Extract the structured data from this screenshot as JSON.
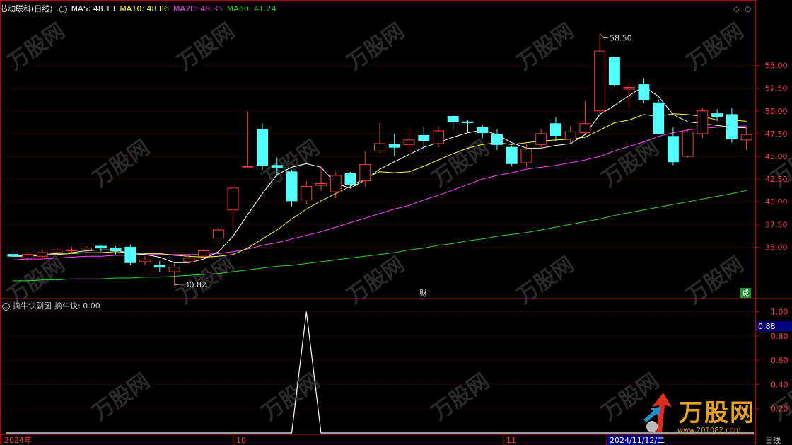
{
  "header": {
    "title": "芯动联科(日线)",
    "ma5": "MA5: 48.13",
    "ma10": "MA10: 48.86",
    "ma20": "MA20: 48.35",
    "ma60": "MA60: 41.24"
  },
  "sub_header": {
    "title": "擒牛诀副图",
    "value": "擒牛诀: 0.00"
  },
  "price_axis_ticks": [
    "55.00",
    "52.50",
    "50.00",
    "47.50",
    "45.00",
    "42.50",
    "40.00",
    "37.50",
    "35.00"
  ],
  "sub_axis_ticks": [
    "1.00",
    "0.80",
    "0.60",
    "0.40",
    "0.20"
  ],
  "sub_current_label": "0.88",
  "date_labels": [
    "2024年",
    "10",
    "11",
    "2024/11/12/二"
  ],
  "period_label": "日线",
  "annotations": {
    "high": "58.50",
    "low": "30.82",
    "cai": "财",
    "jian": "减"
  },
  "watermark": {
    "brand": "万股网",
    "url": "www.201082.com"
  },
  "colors": {
    "up": "#ff3b3b",
    "down": "#54ffff",
    "ma5": "#ffffff",
    "ma10": "#ffff40",
    "ma20": "#ff40ff",
    "ma60": "#30d030",
    "grid": "#800000",
    "axis": "#c00000",
    "tick_text": "#ff4040",
    "sub_line": "#ffffff"
  },
  "chart_data": [
    {
      "type": "candlestick",
      "title": "芯动联科(日线)",
      "y_ticks": [
        35.0,
        37.5,
        40.0,
        42.5,
        45.0,
        47.5,
        50.0,
        52.5,
        55.0
      ],
      "ylim": [
        29.5,
        60.5
      ],
      "candles": [
        {
          "o": 34.2,
          "c": 34.0,
          "h": 34.4,
          "l": 33.8
        },
        {
          "o": 33.8,
          "c": 34.2,
          "h": 34.5,
          "l": 33.4
        },
        {
          "o": 34.0,
          "c": 34.4,
          "h": 34.8,
          "l": 33.7
        },
        {
          "o": 34.4,
          "c": 34.7,
          "h": 34.9,
          "l": 34.1
        },
        {
          "o": 34.6,
          "c": 34.7,
          "h": 35.0,
          "l": 34.3
        },
        {
          "o": 34.7,
          "c": 34.9,
          "h": 35.1,
          "l": 34.4
        },
        {
          "o": 35.1,
          "c": 34.9,
          "h": 35.2,
          "l": 34.5
        },
        {
          "o": 34.9,
          "c": 34.6,
          "h": 35.1,
          "l": 34.2
        },
        {
          "o": 35.0,
          "c": 33.3,
          "h": 35.3,
          "l": 33.0
        },
        {
          "o": 33.4,
          "c": 33.6,
          "h": 34.0,
          "l": 33.0
        },
        {
          "o": 33.0,
          "c": 32.8,
          "h": 33.5,
          "l": 32.3
        },
        {
          "o": 32.3,
          "c": 32.8,
          "h": 33.2,
          "l": 30.82
        },
        {
          "o": 33.4,
          "c": 33.8,
          "h": 34.2,
          "l": 33.2
        },
        {
          "o": 34.0,
          "c": 34.6,
          "h": 34.8,
          "l": 33.8
        },
        {
          "o": 36.0,
          "c": 36.9,
          "h": 37.1,
          "l": 35.9
        },
        {
          "o": 39.1,
          "c": 41.5,
          "h": 41.9,
          "l": 37.3
        },
        {
          "o": 43.9,
          "c": 43.9,
          "h": 49.9,
          "l": 43.9
        },
        {
          "o": 48.0,
          "c": 44.0,
          "h": 48.6,
          "l": 43.5
        },
        {
          "o": 44.0,
          "c": 43.8,
          "h": 44.9,
          "l": 42.8
        },
        {
          "o": 43.3,
          "c": 40.1,
          "h": 43.5,
          "l": 39.5
        },
        {
          "o": 40.2,
          "c": 41.7,
          "h": 42.3,
          "l": 39.7
        },
        {
          "o": 41.8,
          "c": 42.0,
          "h": 44.0,
          "l": 41.2
        },
        {
          "o": 41.1,
          "c": 42.9,
          "h": 43.3,
          "l": 40.4
        },
        {
          "o": 43.1,
          "c": 41.9,
          "h": 43.3,
          "l": 41.6
        },
        {
          "o": 42.3,
          "c": 44.1,
          "h": 45.6,
          "l": 41.7
        },
        {
          "o": 45.6,
          "c": 46.4,
          "h": 48.7,
          "l": 45.4
        },
        {
          "o": 46.3,
          "c": 46.0,
          "h": 47.5,
          "l": 45.0
        },
        {
          "o": 46.3,
          "c": 46.8,
          "h": 48.1,
          "l": 45.3
        },
        {
          "o": 47.3,
          "c": 46.7,
          "h": 48.2,
          "l": 45.7
        },
        {
          "o": 46.4,
          "c": 47.8,
          "h": 48.3,
          "l": 46.0
        },
        {
          "o": 49.4,
          "c": 48.8,
          "h": 49.5,
          "l": 47.9
        },
        {
          "o": 48.8,
          "c": 48.7,
          "h": 49.0,
          "l": 47.7
        },
        {
          "o": 48.2,
          "c": 47.6,
          "h": 48.5,
          "l": 47.0
        },
        {
          "o": 47.4,
          "c": 46.3,
          "h": 48.0,
          "l": 45.7
        },
        {
          "o": 46.0,
          "c": 44.2,
          "h": 46.2,
          "l": 43.9
        },
        {
          "o": 44.3,
          "c": 45.8,
          "h": 46.4,
          "l": 43.8
        },
        {
          "o": 46.3,
          "c": 47.5,
          "h": 48.0,
          "l": 45.9
        },
        {
          "o": 48.6,
          "c": 47.3,
          "h": 49.3,
          "l": 46.7
        },
        {
          "o": 46.9,
          "c": 47.7,
          "h": 48.3,
          "l": 46.4
        },
        {
          "o": 47.6,
          "c": 48.6,
          "h": 51.1,
          "l": 47.4
        },
        {
          "o": 50.0,
          "c": 56.6,
          "h": 58.5,
          "l": 49.7
        },
        {
          "o": 55.9,
          "c": 52.9,
          "h": 56.0,
          "l": 52.7
        },
        {
          "o": 52.4,
          "c": 52.6,
          "h": 53.1,
          "l": 50.2
        },
        {
          "o": 52.9,
          "c": 51.2,
          "h": 53.6,
          "l": 50.9
        },
        {
          "o": 50.9,
          "c": 47.5,
          "h": 51.3,
          "l": 47.4
        },
        {
          "o": 47.2,
          "c": 44.4,
          "h": 48.2,
          "l": 44.0
        },
        {
          "o": 45.0,
          "c": 47.7,
          "h": 48.0,
          "l": 44.8
        },
        {
          "o": 47.5,
          "c": 50.0,
          "h": 50.3,
          "l": 47.0
        },
        {
          "o": 49.7,
          "c": 49.4,
          "h": 50.2,
          "l": 48.9
        },
        {
          "o": 49.6,
          "c": 46.9,
          "h": 50.3,
          "l": 46.5
        },
        {
          "o": 46.8,
          "c": 47.4,
          "h": 48.2,
          "l": 45.7
        }
      ],
      "ma5": [
        34.0,
        34.1,
        34.2,
        34.3,
        34.4,
        34.6,
        34.7,
        34.7,
        34.3,
        34.2,
        33.9,
        33.3,
        33.3,
        33.7,
        34.5,
        36.2,
        38.6,
        40.9,
        43.0,
        43.8,
        44.2,
        43.8,
        42.0,
        41.5,
        42.4,
        43.6,
        44.4,
        45.2,
        46.0,
        46.5,
        47.1,
        47.6,
        47.9,
        47.4,
        46.5,
        45.9,
        45.9,
        46.2,
        46.4,
        47.4,
        49.6,
        50.6,
        51.7,
        52.7,
        51.6,
        49.6,
        48.8,
        48.6,
        48.4,
        48.2,
        48.13
      ],
      "ma10": [
        34.0,
        34.0,
        34.1,
        34.2,
        34.3,
        34.4,
        34.4,
        34.5,
        34.4,
        34.3,
        34.3,
        34.1,
        34.0,
        33.9,
        34.0,
        34.2,
        34.9,
        35.9,
        36.9,
        38.1,
        39.2,
        40.1,
        40.9,
        41.7,
        42.6,
        43.3,
        43.2,
        43.3,
        43.9,
        44.6,
        45.3,
        45.9,
        46.3,
        46.5,
        46.3,
        46.5,
        46.7,
        46.8,
        46.9,
        47.1,
        47.9,
        48.7,
        49.0,
        49.6,
        49.4,
        49.7,
        49.6,
        49.4,
        49.0,
        49.0,
        48.86
      ],
      "ma20": [
        33.6,
        33.7,
        33.7,
        33.8,
        33.9,
        34.0,
        34.0,
        34.1,
        34.1,
        34.2,
        34.2,
        34.2,
        34.2,
        34.2,
        34.3,
        34.5,
        34.8,
        35.2,
        35.5,
        35.9,
        36.3,
        36.7,
        37.2,
        37.7,
        38.2,
        38.7,
        39.2,
        39.6,
        40.2,
        40.7,
        41.3,
        41.9,
        42.5,
        42.9,
        43.2,
        43.6,
        43.8,
        44.0,
        44.3,
        44.6,
        45.0,
        45.6,
        46.1,
        46.6,
        47.2,
        47.6,
        47.9,
        48.1,
        48.2,
        48.3,
        48.35
      ],
      "ma60": [
        31.3,
        31.3,
        31.4,
        31.4,
        31.5,
        31.5,
        31.5,
        31.6,
        31.6,
        31.7,
        31.7,
        31.8,
        31.9,
        32.0,
        32.1,
        32.3,
        32.5,
        32.7,
        32.9,
        33.0,
        33.2,
        33.4,
        33.6,
        33.8,
        34.0,
        34.2,
        34.4,
        34.7,
        34.9,
        35.2,
        35.4,
        35.7,
        35.9,
        36.2,
        36.4,
        36.6,
        36.9,
        37.2,
        37.5,
        37.8,
        38.1,
        38.5,
        38.8,
        39.1,
        39.4,
        39.7,
        40.0,
        40.3,
        40.6,
        40.9,
        41.24
      ],
      "high_label": "58.50",
      "low_label": "30.82"
    },
    {
      "type": "line",
      "title": "擒牛诀副图",
      "y_ticks": [
        0.2,
        0.4,
        0.6,
        0.8,
        1.0
      ],
      "ylim": [
        0,
        1.05
      ],
      "values": [
        0,
        0,
        0,
        0,
        0,
        0,
        0,
        0,
        0,
        0,
        0,
        0,
        0,
        0,
        0,
        0,
        0,
        0,
        0,
        0,
        1,
        0,
        0,
        0,
        0,
        0,
        0,
        0,
        0,
        0,
        0,
        0,
        0,
        0,
        0,
        0,
        0,
        0,
        0,
        0,
        0,
        0,
        0,
        0,
        0,
        0,
        0,
        0,
        0,
        0,
        0
      ]
    }
  ]
}
